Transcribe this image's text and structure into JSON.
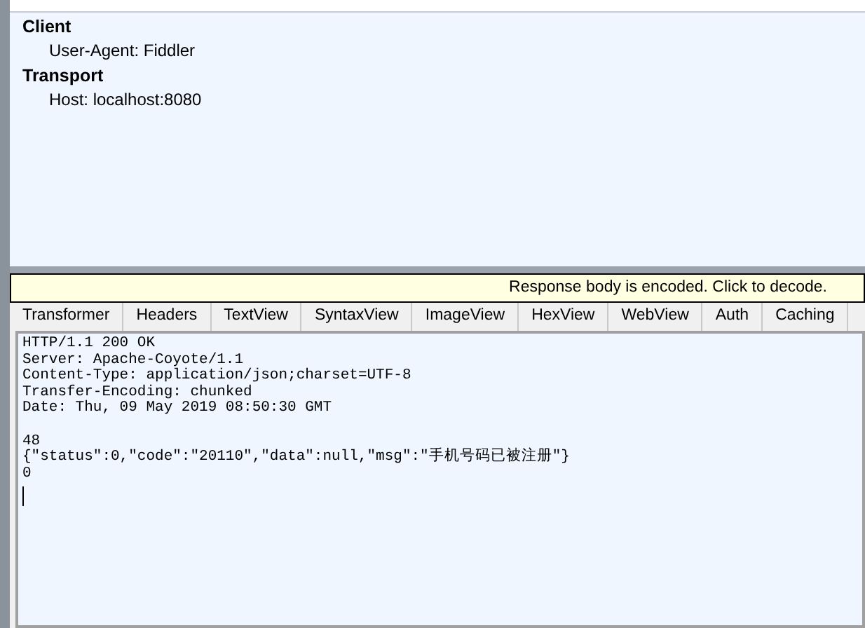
{
  "request_headers": [
    {
      "group": "Client",
      "items": [
        "User-Agent: Fiddler"
      ]
    },
    {
      "group": "Transport",
      "items": [
        "Host: localhost:8080"
      ]
    }
  ],
  "notice": "Response body is encoded. Click to decode.",
  "tabs": [
    {
      "label": "Transformer",
      "selected": false
    },
    {
      "label": "Headers",
      "selected": false
    },
    {
      "label": "TextView",
      "selected": false
    },
    {
      "label": "SyntaxView",
      "selected": false
    },
    {
      "label": "ImageView",
      "selected": false
    },
    {
      "label": "HexView",
      "selected": false
    },
    {
      "label": "WebView",
      "selected": false
    },
    {
      "label": "Auth",
      "selected": false
    },
    {
      "label": "Caching",
      "selected": false
    }
  ],
  "response_head": [
    "HTTP/1.1 200 OK",
    "Server: Apache-Coyote/1.1",
    "Content-Type: application/json;charset=UTF-8",
    "Transfer-Encoding: chunked",
    "Date: Thu, 09 May 2019 08:50:30 GMT"
  ],
  "response_body": [
    "48",
    "{\"status\":0,\"code\":\"20110\",\"data\":null,\"msg\":\"手机号码已被注册\"}",
    "0"
  ]
}
